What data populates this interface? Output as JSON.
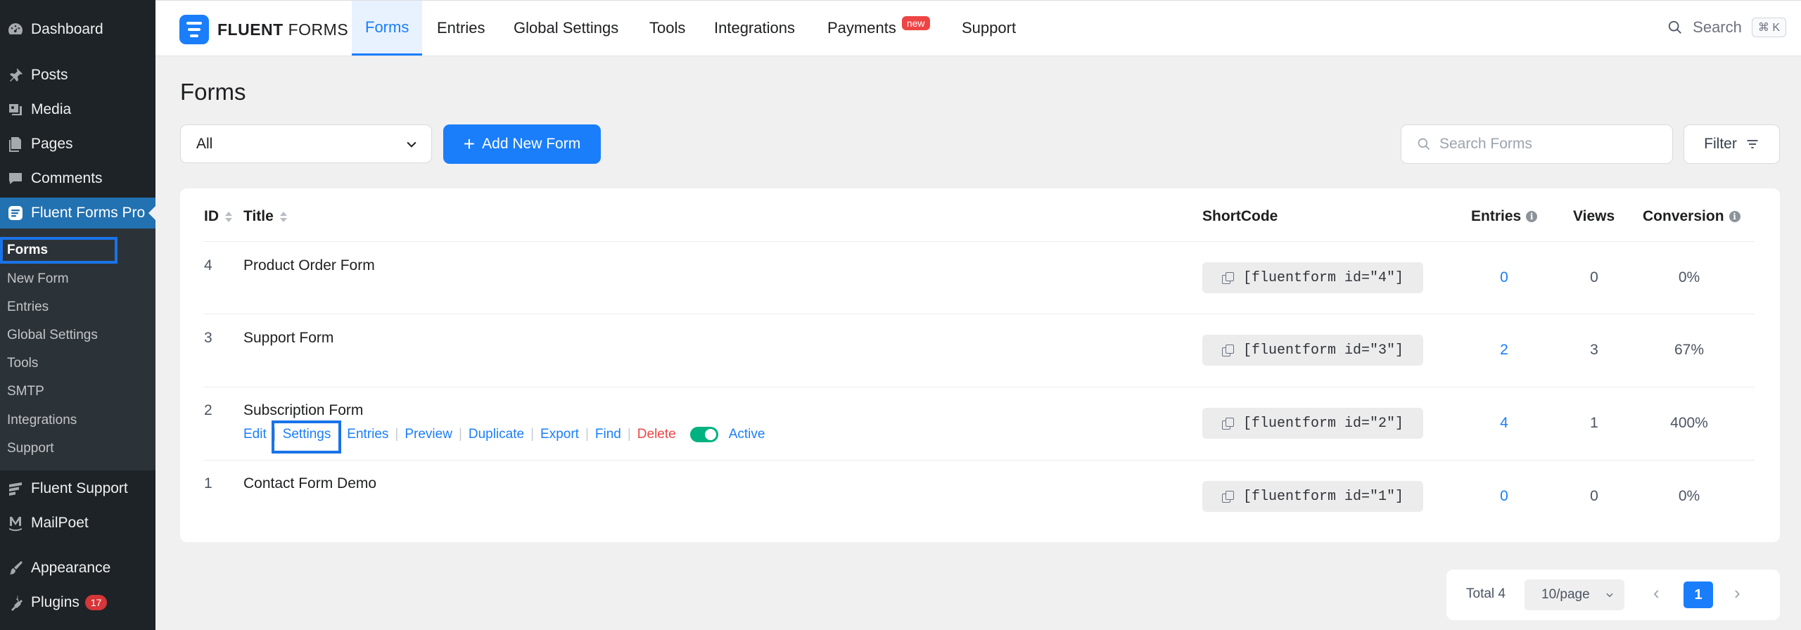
{
  "wp_menu": {
    "dashboard": "Dashboard",
    "posts": "Posts",
    "media": "Media",
    "pages": "Pages",
    "comments": "Comments",
    "fluent_forms": "Fluent Forms Pro",
    "fluent_support": "Fluent Support",
    "mailpoet": "MailPoet",
    "appearance": "Appearance",
    "plugins": "Plugins",
    "plugins_badge": "17"
  },
  "wp_submenu": [
    "Forms",
    "New Form",
    "Entries",
    "Global Settings",
    "Tools",
    "SMTP",
    "Integrations",
    "Support"
  ],
  "logo": {
    "bold": "FLUENT",
    "light": "FORMS"
  },
  "nav": {
    "tabs": [
      "Forms",
      "Entries",
      "Global Settings",
      "Tools",
      "Integrations",
      "Payments",
      "Support"
    ],
    "payments_badge": "new",
    "search_label": "Search",
    "search_shortcut": "⌘ K"
  },
  "page": {
    "title": "Forms",
    "status_filter": "All",
    "add_button": "Add New Form",
    "search_placeholder": "Search Forms",
    "filter_button": "Filter"
  },
  "table": {
    "headers": {
      "id": "ID",
      "title": "Title",
      "shortcode": "ShortCode",
      "entries": "Entries",
      "views": "Views",
      "conversion": "Conversion"
    },
    "rows": [
      {
        "id": "4",
        "title": "Product Order Form",
        "shortcode": "[fluentform id=\"4\"]",
        "entries": "0",
        "views": "0",
        "conversion": "0%"
      },
      {
        "id": "3",
        "title": "Support Form",
        "shortcode": "[fluentform id=\"3\"]",
        "entries": "2",
        "views": "3",
        "conversion": "67%"
      },
      {
        "id": "2",
        "title": "Subscription Form",
        "shortcode": "[fluentform id=\"2\"]",
        "entries": "4",
        "views": "1",
        "conversion": "400%"
      },
      {
        "id": "1",
        "title": "Contact Form Demo",
        "shortcode": "[fluentform id=\"1\"]",
        "entries": "0",
        "views": "0",
        "conversion": "0%"
      }
    ],
    "row_actions": [
      "Edit",
      "Settings",
      "Entries",
      "Preview",
      "Duplicate",
      "Export",
      "Find",
      "Delete"
    ],
    "status_label": "Active"
  },
  "pagination": {
    "total": "Total 4",
    "per_page": "10/page",
    "current_page": "1"
  },
  "colors": {
    "brand": "#1a7efb",
    "wp_sidebar": "#1d2327",
    "wp_active": "#2271b1",
    "toggle_on": "#00b27f",
    "delete": "#ef4444",
    "highlight": "#1a73e8"
  }
}
